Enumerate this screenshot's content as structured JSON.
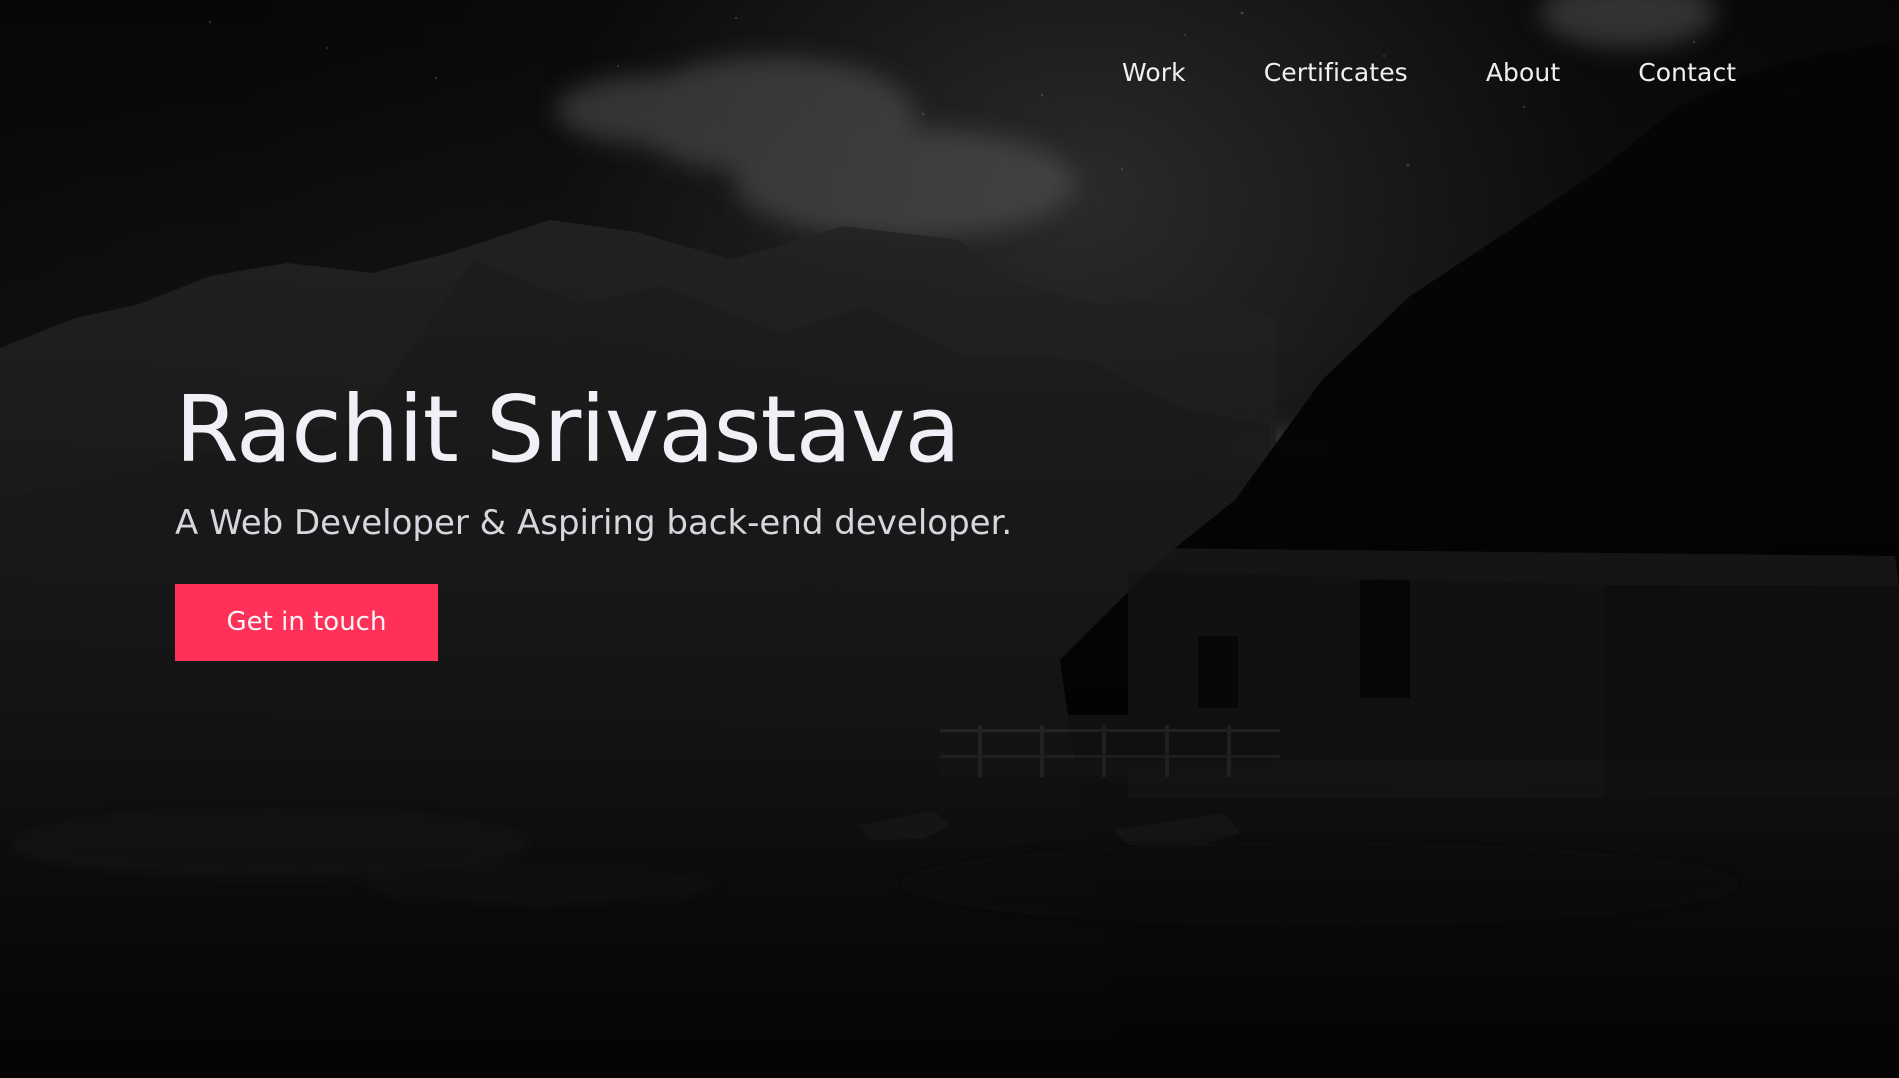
{
  "navigation": {
    "items": [
      {
        "label": "Work"
      },
      {
        "label": "Certificates"
      },
      {
        "label": "About"
      },
      {
        "label": "Contact"
      }
    ]
  },
  "hero": {
    "title": "Rachit Srivastava",
    "subtitle": "A Web Developer & Aspiring back-end developer.",
    "cta_label": "Get in touch",
    "accent_color": "#ff3158"
  },
  "background": {
    "icon": "night-landscape-image"
  }
}
